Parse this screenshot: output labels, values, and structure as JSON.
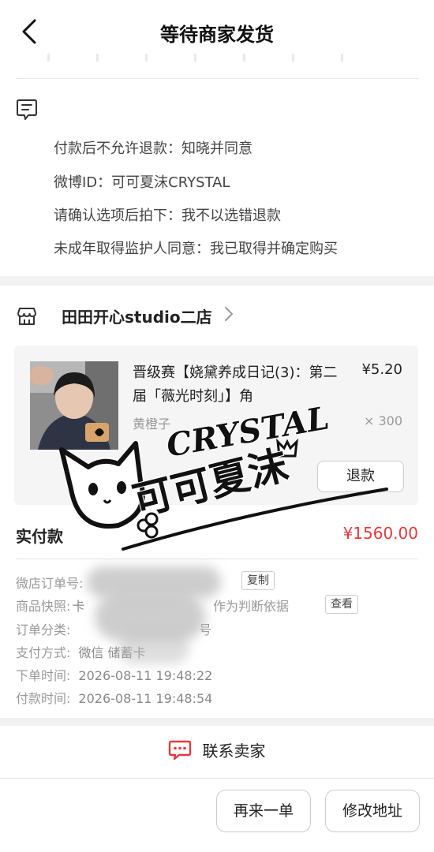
{
  "header": {
    "title": "等待商家发货"
  },
  "remarks": [
    "付款后不允许退款：知晓并同意",
    "微博ID：可可夏沫CRYSTAL",
    "请确认选项后拍下：我不以选错退款",
    "未成年取得监护人同意：我已取得并确定购买"
  ],
  "shop": {
    "name": "田田开心studio二店",
    "item": {
      "title": "晋级赛【娆黛养成日记(3)：第二届「薇光时刻」】角",
      "price": "¥5.20",
      "spec": "黄橙子",
      "qty": "× 300",
      "refund_label": "退款"
    },
    "paid_label": "实付款",
    "paid_amount": "¥1560.00"
  },
  "order_info": {
    "order_no_label": "微店订单号:",
    "copy_label": "复制",
    "snapshot_label": "商品快照:",
    "snapshot_value_start": "卡",
    "snapshot_value_end": "作为判断依据",
    "view_label": "查看",
    "category_label": "订单分类:",
    "category_value_end": "号",
    "pay_method_label": "支付方式:",
    "pay_method_value": "微信 储蓄卡",
    "order_time_label": "下单时间:",
    "order_time_value": "2026-08-11 19:48:22",
    "pay_time_label": "付款时间:",
    "pay_time_value": "2026-08-11 19:48:54"
  },
  "contact": {
    "label": "联系卖家"
  },
  "actions": {
    "reorder_label": "再来一单",
    "edit_address_label": "修改地址"
  },
  "watermark": {
    "brand": "CRYSTAL",
    "name": "可可夏沫"
  },
  "colors": {
    "accent_red": "#e4393c",
    "page_bg": "#f2f2f2"
  }
}
